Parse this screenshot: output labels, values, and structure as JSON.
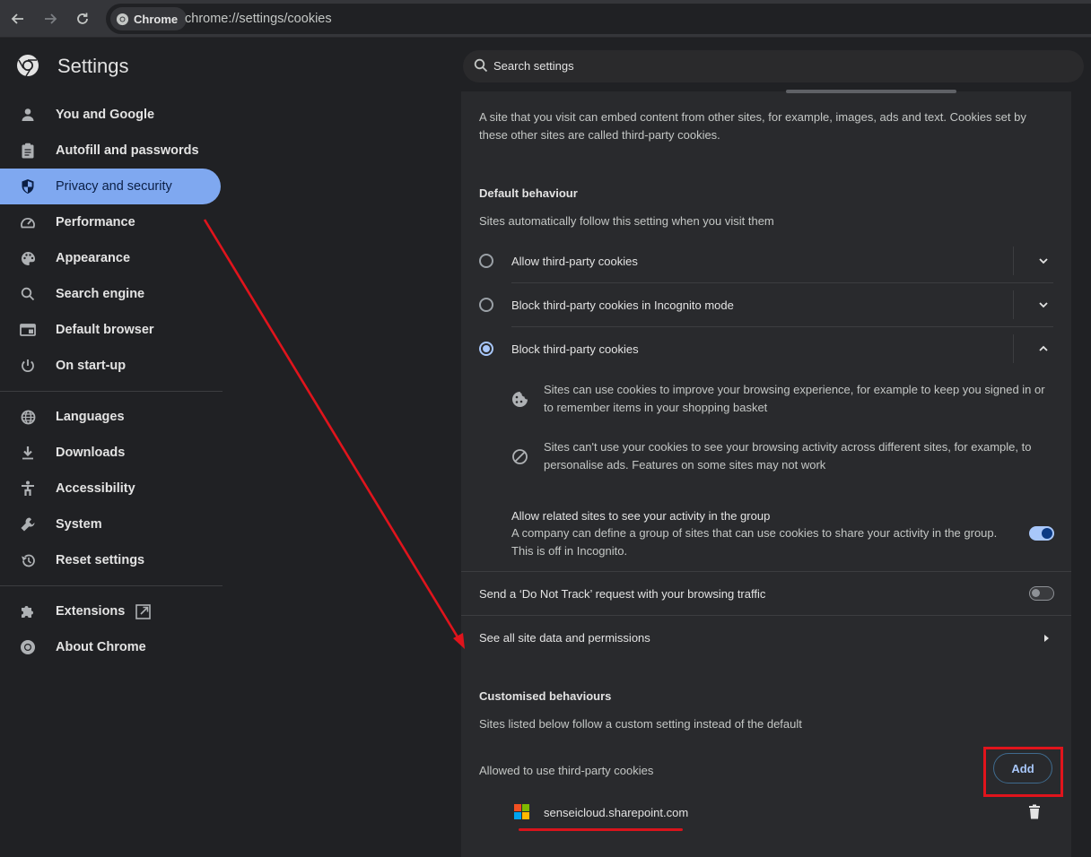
{
  "browser": {
    "chip_label": "Chrome",
    "url": "chrome://settings/cookies"
  },
  "header": {
    "title": "Settings",
    "search_placeholder": "Search settings"
  },
  "sidebar": {
    "items": [
      {
        "label": "You and Google",
        "icon": "person-icon"
      },
      {
        "label": "Autofill and passwords",
        "icon": "clipboard-icon"
      },
      {
        "label": "Privacy and security",
        "icon": "shield-icon",
        "active": true
      },
      {
        "label": "Performance",
        "icon": "speedometer-icon"
      },
      {
        "label": "Appearance",
        "icon": "palette-icon"
      },
      {
        "label": "Search engine",
        "icon": "search-icon"
      },
      {
        "label": "Default browser",
        "icon": "browser-window-icon"
      },
      {
        "label": "On start-up",
        "icon": "power-icon"
      },
      {
        "label": "Languages",
        "icon": "globe-icon"
      },
      {
        "label": "Downloads",
        "icon": "download-icon"
      },
      {
        "label": "Accessibility",
        "icon": "accessibility-icon"
      },
      {
        "label": "System",
        "icon": "wrench-icon"
      },
      {
        "label": "Reset settings",
        "icon": "history-icon"
      },
      {
        "label": "Extensions",
        "icon": "puzzle-icon"
      },
      {
        "label": "About Chrome",
        "icon": "chrome-icon"
      }
    ]
  },
  "content": {
    "intro": "A site that you visit can embed content from other sites, for example, images, ads and text. Cookies set by these other sites are called third-party cookies.",
    "default_heading": "Default behaviour",
    "default_sub": "Sites automatically follow this setting when you visit them",
    "options": [
      {
        "label": "Allow third-party cookies",
        "selected": false,
        "expanded": false
      },
      {
        "label": "Block third-party cookies in Incognito mode",
        "selected": false,
        "expanded": false
      },
      {
        "label": "Block third-party cookies",
        "selected": true,
        "expanded": true
      }
    ],
    "details": [
      {
        "icon": "cookie-icon",
        "text": "Sites can use cookies to improve your browsing experience, for example to keep you signed in or to remember items in your shopping basket"
      },
      {
        "icon": "block-icon",
        "text": "Sites can't use your cookies to see your browsing activity across different sites, for example, to personalise ads. Features on some sites may not work"
      }
    ],
    "related_sites": {
      "title": "Allow related sites to see your activity in the group",
      "desc_line1": "A company can define a group of sites that can use cookies to share your activity in the group.",
      "desc_line2": "This is off in Incognito.",
      "enabled": true
    },
    "do_not_track": {
      "label": "Send a ‘Do Not Track’ request with your browsing traffic",
      "enabled": false
    },
    "site_data_link": "See all site data and permissions",
    "custom_heading": "Customised behaviours",
    "custom_sub": "Sites listed below follow a custom setting instead of the default",
    "allowed_label": "Allowed to use third-party cookies",
    "add_button": "Add",
    "allowed_sites": [
      {
        "domain": "senseicloud.sharepoint.com",
        "icon": "microsoft-logo-icon"
      }
    ]
  },
  "colors": {
    "accent": "#a8c7fa",
    "active_nav": "#7fa8f0",
    "annotation": "#e0141c"
  }
}
